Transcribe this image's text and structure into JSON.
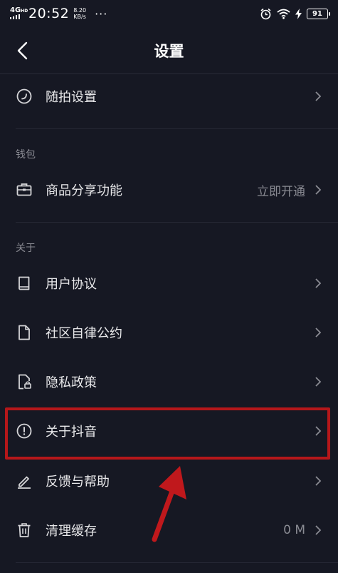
{
  "status_bar": {
    "network": "4G",
    "network_sup": "HD",
    "time": "20:52",
    "speed_value": "8.20",
    "speed_unit": "KB/s",
    "more": "···",
    "battery": "91"
  },
  "nav": {
    "title": "设置"
  },
  "rows": {
    "suipai": {
      "label": "随拍设置"
    },
    "wallet_header": "钱包",
    "share": {
      "label": "商品分享功能",
      "value": "立即开通"
    },
    "about_header": "关于",
    "agreement": {
      "label": "用户协议"
    },
    "community": {
      "label": "社区自律公约"
    },
    "privacy": {
      "label": "隐私政策"
    },
    "about": {
      "label": "关于抖音"
    },
    "feedback": {
      "label": "反馈与帮助"
    },
    "cache": {
      "label": "清理缓存",
      "value": "0 M"
    }
  },
  "colors": {
    "background": "#161823",
    "highlight": "#b5171a"
  }
}
